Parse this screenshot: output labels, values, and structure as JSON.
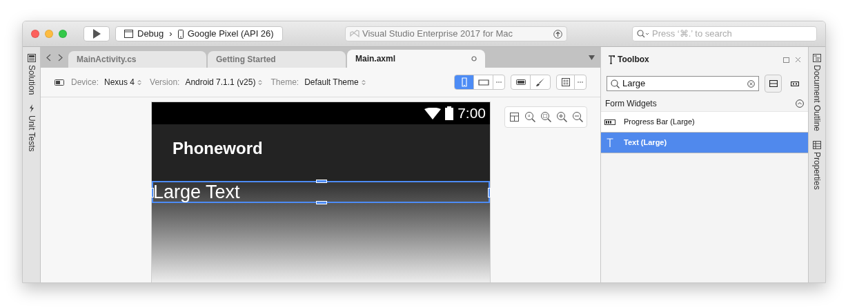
{
  "window": {
    "title": "Visual Studio Enterprise 2017 for Mac"
  },
  "toolbar": {
    "configuration": "Debug",
    "separator": "›",
    "device": "Google Pixel (API 26)",
    "search_placeholder": "Press ‘⌘.’ to search"
  },
  "left_pads": [
    {
      "label": "Solution",
      "kind": "solution"
    },
    {
      "label": "Unit Tests",
      "kind": "tests"
    }
  ],
  "tabs": [
    {
      "label": "MainActivity.cs",
      "selected": false
    },
    {
      "label": "Getting Started",
      "selected": false
    },
    {
      "label": "Main.axml",
      "selected": true
    }
  ],
  "designer": {
    "settings": [
      {
        "label": "Device:",
        "value": "Nexus 4"
      },
      {
        "label": "Version:",
        "value": "Android 7.1.1 (v25)"
      },
      {
        "label": "Theme:",
        "value": "Default Theme"
      }
    ],
    "orientations": [
      {
        "kind": "portrait",
        "selected": true
      },
      {
        "kind": "landscape",
        "selected": false
      }
    ]
  },
  "phone": {
    "time": "7:00",
    "app_title": "Phoneword",
    "widgets": [
      {
        "text": "Large Text",
        "selected": true
      }
    ]
  },
  "toolbox": {
    "title": "Toolbox",
    "search": "Large",
    "categories": [
      {
        "name": "Form Widgets",
        "expanded": true,
        "items": [
          {
            "label": "Progress Bar (Large)",
            "kind": "progress",
            "selected": false
          },
          {
            "label": "Text (Large)",
            "kind": "text",
            "selected": true
          }
        ]
      }
    ]
  },
  "right_pads": [
    {
      "label": "Document Outline",
      "kind": "outline"
    },
    {
      "label": "Properties",
      "kind": "properties"
    }
  ]
}
